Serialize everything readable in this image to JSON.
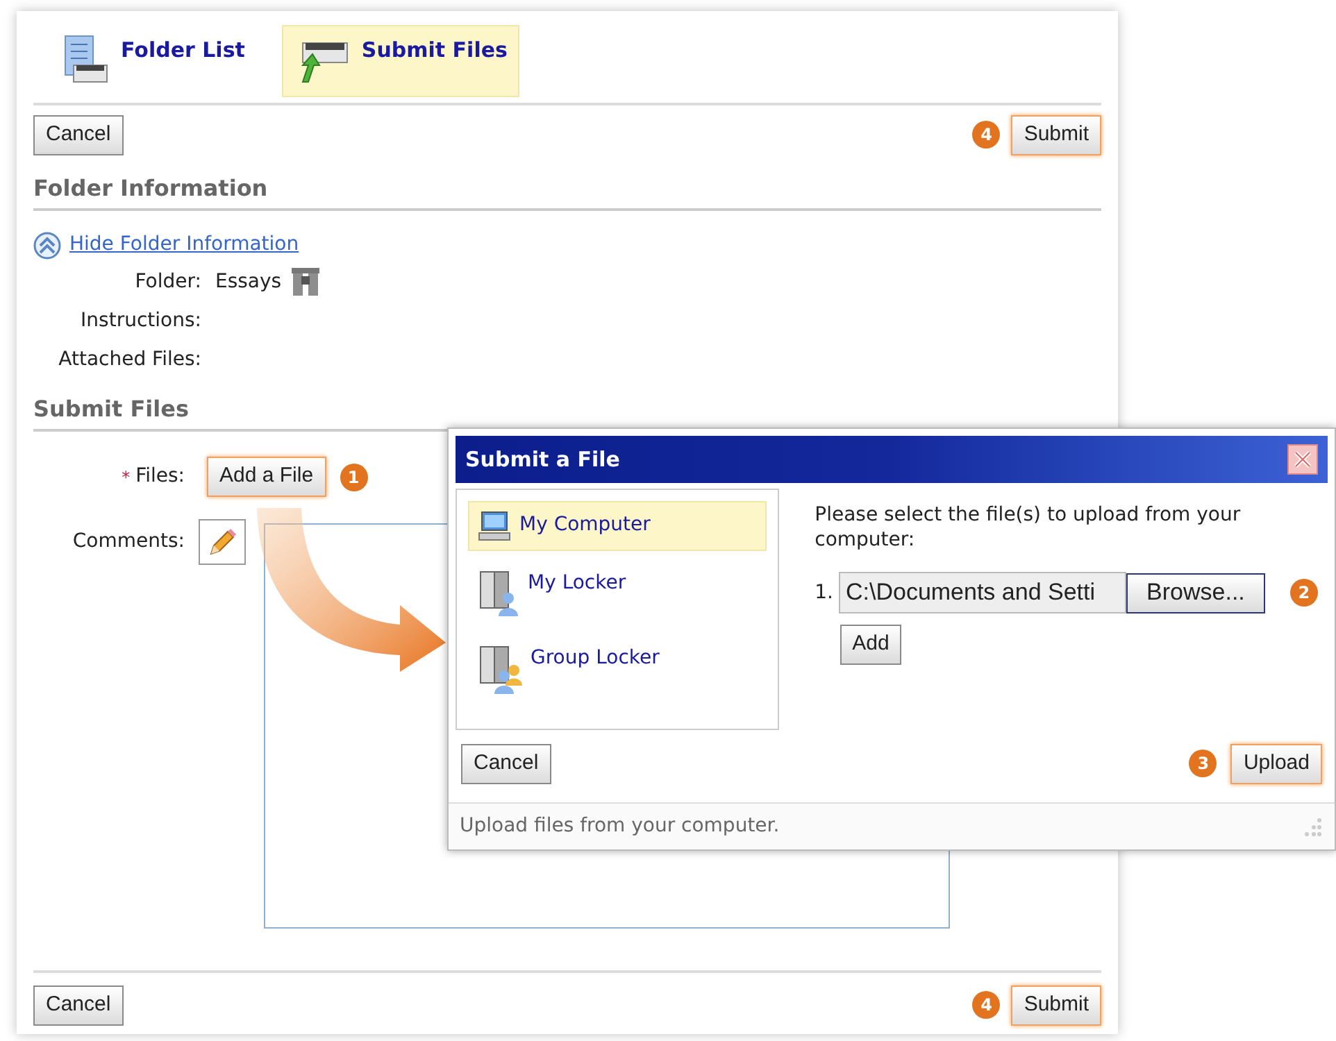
{
  "tabs": [
    {
      "label": "Folder List",
      "selected": false
    },
    {
      "label": "Submit Files",
      "selected": true
    }
  ],
  "top_bar": {
    "cancel": "Cancel",
    "submit": "Submit",
    "submit_step": "4"
  },
  "folder_info": {
    "heading": "Folder Information",
    "toggle_link": "Hide Folder Information",
    "fields": [
      {
        "label": "Folder:",
        "value": "Essays"
      },
      {
        "label": "Instructions:"
      },
      {
        "label": "Attached Files:"
      }
    ]
  },
  "submit_files": {
    "heading": "Submit Files",
    "files_label": "Files:",
    "required_mark": "*",
    "add_button": "Add a File",
    "add_step": "1",
    "comments_label": "Comments:"
  },
  "bottom_bar": {
    "cancel": "Cancel",
    "submit": "Submit",
    "submit_step": "4"
  },
  "dialog": {
    "title": "Submit a File",
    "sources": [
      {
        "label": "My Computer",
        "kind": "computer",
        "selected": true
      },
      {
        "label": "My Locker",
        "kind": "locker",
        "selected": false
      },
      {
        "label": "Group Locker",
        "kind": "group",
        "selected": false
      }
    ],
    "prompt": "Please select the file(s) to upload from your computer:",
    "file_rows": [
      {
        "number": "1.",
        "value": "C:\\Documents and Setti",
        "browse": "Browse...",
        "step": "2"
      }
    ],
    "add": "Add",
    "cancel": "Cancel",
    "upload": "Upload",
    "upload_step": "3",
    "status": "Upload files from your computer."
  }
}
